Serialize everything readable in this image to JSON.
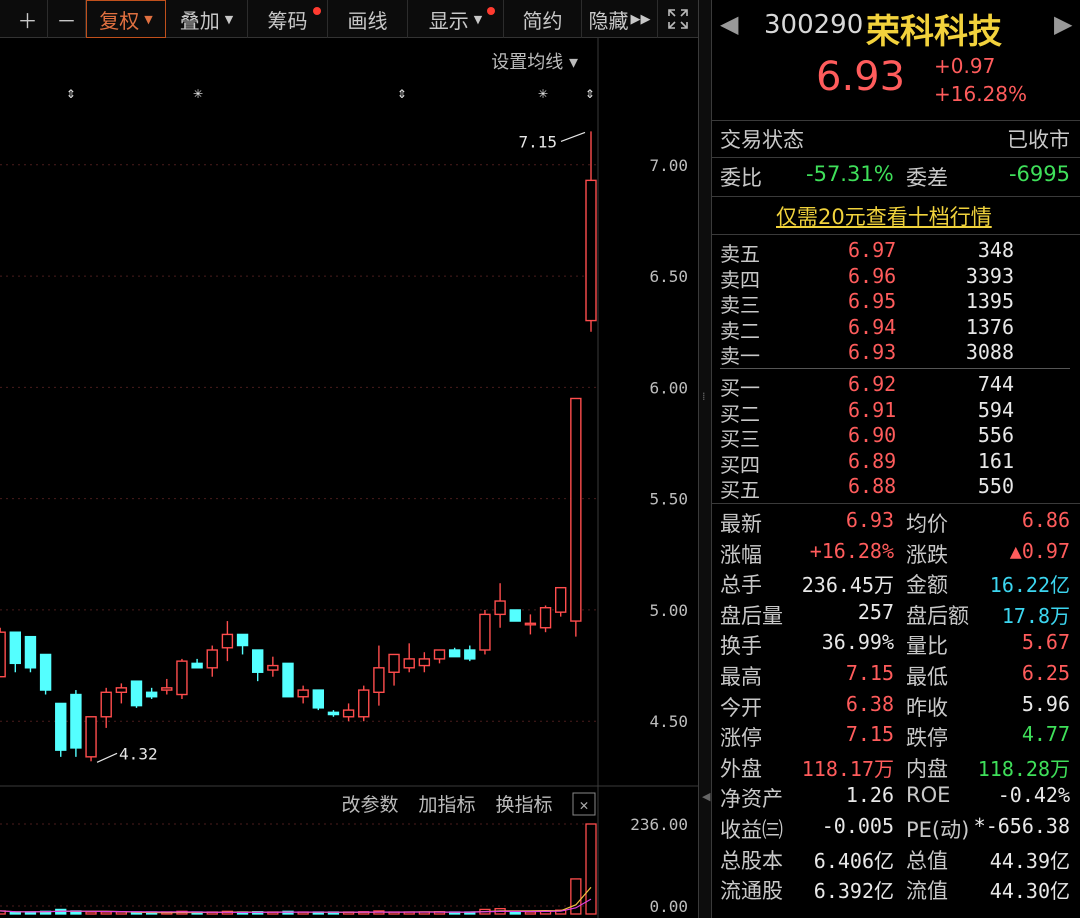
{
  "toolbar": {
    "plus": "＋",
    "minus": "－",
    "fuquan": "复权",
    "diejia": "叠加",
    "chouma": "筹码",
    "huaxian": "画线",
    "xianshi": "显示",
    "jianyue": "简约",
    "yincang": "隐藏",
    "expand_icon": "expand-icon",
    "badge_color": "#ff3b30"
  },
  "chart": {
    "ma_setting": "设置均线",
    "high_label": "7.15",
    "low_label": "4.32",
    "indicator_buttons": [
      "改参数",
      "加指标",
      "换指标"
    ],
    "volume_ticks": [
      "236.00",
      "0.00"
    ],
    "up_color": "#ff4d4d",
    "down_color": "#54ffff"
  },
  "chart_data": {
    "type": "candlestick",
    "y_ticks": [
      "7.00",
      "6.50",
      "6.00",
      "5.50",
      "5.00",
      "4.50"
    ],
    "ylim": [
      4.2,
      7.3
    ],
    "candles": [
      {
        "o": 4.7,
        "h": 4.92,
        "l": 4.7,
        "c": 4.9
      },
      {
        "o": 4.9,
        "h": 4.9,
        "l": 4.72,
        "c": 4.76
      },
      {
        "o": 4.88,
        "h": 4.88,
        "l": 4.72,
        "c": 4.74
      },
      {
        "o": 4.8,
        "h": 4.8,
        "l": 4.62,
        "c": 4.64
      },
      {
        "o": 4.58,
        "h": 4.58,
        "l": 4.34,
        "c": 4.37
      },
      {
        "o": 4.62,
        "h": 4.64,
        "l": 4.34,
        "c": 4.38
      },
      {
        "o": 4.34,
        "h": 4.52,
        "l": 4.32,
        "c": 4.52
      },
      {
        "o": 4.52,
        "h": 4.65,
        "l": 4.47,
        "c": 4.63
      },
      {
        "o": 4.63,
        "h": 4.67,
        "l": 4.58,
        "c": 4.65
      },
      {
        "o": 4.68,
        "h": 4.68,
        "l": 4.56,
        "c": 4.57
      },
      {
        "o": 4.63,
        "h": 4.65,
        "l": 4.6,
        "c": 4.61
      },
      {
        "o": 4.64,
        "h": 4.69,
        "l": 4.62,
        "c": 4.65
      },
      {
        "o": 4.62,
        "h": 4.78,
        "l": 4.6,
        "c": 4.77
      },
      {
        "o": 4.76,
        "h": 4.78,
        "l": 4.74,
        "c": 4.74
      },
      {
        "o": 4.74,
        "h": 4.84,
        "l": 4.7,
        "c": 4.82
      },
      {
        "o": 4.83,
        "h": 4.95,
        "l": 4.77,
        "c": 4.89
      },
      {
        "o": 4.89,
        "h": 4.89,
        "l": 4.8,
        "c": 4.84
      },
      {
        "o": 4.82,
        "h": 4.82,
        "l": 4.68,
        "c": 4.72
      },
      {
        "o": 4.73,
        "h": 4.79,
        "l": 4.7,
        "c": 4.75
      },
      {
        "o": 4.76,
        "h": 4.76,
        "l": 4.62,
        "c": 4.61
      },
      {
        "o": 4.61,
        "h": 4.66,
        "l": 4.58,
        "c": 4.64
      },
      {
        "o": 4.64,
        "h": 4.64,
        "l": 4.55,
        "c": 4.56
      },
      {
        "o": 4.54,
        "h": 4.55,
        "l": 4.52,
        "c": 4.53
      },
      {
        "o": 4.52,
        "h": 4.58,
        "l": 4.5,
        "c": 4.55
      },
      {
        "o": 4.52,
        "h": 4.66,
        "l": 4.5,
        "c": 4.64
      },
      {
        "o": 4.63,
        "h": 4.84,
        "l": 4.57,
        "c": 4.74
      },
      {
        "o": 4.72,
        "h": 4.8,
        "l": 4.66,
        "c": 4.8
      },
      {
        "o": 4.74,
        "h": 4.85,
        "l": 4.72,
        "c": 4.78
      },
      {
        "o": 4.75,
        "h": 4.81,
        "l": 4.72,
        "c": 4.78
      },
      {
        "o": 4.78,
        "h": 4.82,
        "l": 4.76,
        "c": 4.82
      },
      {
        "o": 4.82,
        "h": 4.83,
        "l": 4.79,
        "c": 4.79
      },
      {
        "o": 4.82,
        "h": 4.84,
        "l": 4.77,
        "c": 4.78
      },
      {
        "o": 4.82,
        "h": 5.0,
        "l": 4.8,
        "c": 4.98
      },
      {
        "o": 4.98,
        "h": 5.12,
        "l": 4.92,
        "c": 5.04
      },
      {
        "o": 5.0,
        "h": 5.0,
        "l": 4.95,
        "c": 4.95
      },
      {
        "o": 4.94,
        "h": 4.98,
        "l": 4.89,
        "c": 4.94
      },
      {
        "o": 4.92,
        "h": 5.02,
        "l": 4.9,
        "c": 5.01
      },
      {
        "o": 4.99,
        "h": 5.1,
        "l": 4.97,
        "c": 5.1
      },
      {
        "o": 4.95,
        "h": 5.95,
        "l": 4.88,
        "c": 5.95
      },
      {
        "o": 6.3,
        "h": 7.15,
        "l": 6.25,
        "c": 6.93
      }
    ],
    "volume": [
      8,
      4,
      5,
      7,
      12,
      8,
      5,
      4,
      3,
      3,
      4,
      3,
      7,
      3,
      5,
      7,
      4,
      6,
      3,
      7,
      4,
      5,
      3,
      4,
      6,
      8,
      4,
      5,
      5,
      6,
      4,
      5,
      12,
      14,
      6,
      5,
      7,
      10,
      92,
      236
    ]
  },
  "stock": {
    "code": "300290",
    "name": "荣科科技",
    "price": "6.93",
    "change": "+0.97",
    "change_pct": "+16.28%",
    "trade_status_label": "交易状态",
    "trade_status": "已收市",
    "weibi_label": "委比",
    "weibi": "-57.31%",
    "weicha_label": "委差",
    "weicha": "-6995",
    "promo": "仅需20元查看十档行情"
  },
  "orderbook": {
    "sell": [
      {
        "label": "卖五",
        "price": "6.97",
        "vol": "348"
      },
      {
        "label": "卖四",
        "price": "6.96",
        "vol": "3393"
      },
      {
        "label": "卖三",
        "price": "6.95",
        "vol": "1395"
      },
      {
        "label": "卖二",
        "price": "6.94",
        "vol": "1376"
      },
      {
        "label": "卖一",
        "price": "6.93",
        "vol": "3088"
      }
    ],
    "buy": [
      {
        "label": "买一",
        "price": "6.92",
        "vol": "744"
      },
      {
        "label": "买二",
        "price": "6.91",
        "vol": "594"
      },
      {
        "label": "买三",
        "price": "6.90",
        "vol": "556"
      },
      {
        "label": "买四",
        "price": "6.89",
        "vol": "161"
      },
      {
        "label": "买五",
        "price": "6.88",
        "vol": "550"
      }
    ]
  },
  "quote": [
    {
      "l1": "最新",
      "v1": "6.93",
      "c1": "red",
      "l2": "均价",
      "v2": "6.86",
      "c2": "red"
    },
    {
      "l1": "涨幅",
      "v1": "+16.28%",
      "c1": "red",
      "l2": "涨跌",
      "v2": "▲0.97",
      "c2": "red"
    },
    {
      "l1": "总手",
      "v1": "236.45万",
      "c1": "white",
      "l2": "金额",
      "v2": "16.22亿",
      "c2": "cyan"
    },
    {
      "l1": "盘后量",
      "v1": "257",
      "c1": "white",
      "l2": "盘后额",
      "v2": "17.8万",
      "c2": "cyan"
    },
    {
      "l1": "换手",
      "v1": "36.99%",
      "c1": "white",
      "l2": "量比",
      "v2": "5.67",
      "c2": "red"
    },
    {
      "l1": "最高",
      "v1": "7.15",
      "c1": "red",
      "l2": "最低",
      "v2": "6.25",
      "c2": "red"
    },
    {
      "l1": "今开",
      "v1": "6.38",
      "c1": "red",
      "l2": "昨收",
      "v2": "5.96",
      "c2": "white"
    },
    {
      "l1": "涨停",
      "v1": "7.15",
      "c1": "red",
      "l2": "跌停",
      "v2": "4.77",
      "c2": "green"
    },
    {
      "l1": "外盘",
      "v1": "118.17万",
      "c1": "red",
      "l2": "内盘",
      "v2": "118.28万",
      "c2": "green"
    },
    {
      "l1": "净资产",
      "v1": "1.26",
      "c1": "white",
      "l2": "ROE",
      "v2": "-0.42%",
      "c2": "white"
    },
    {
      "l1": "收益㈢",
      "v1": "-0.005",
      "c1": "white",
      "l2": "PE(动)",
      "v2": "*-656.38",
      "c2": "white"
    },
    {
      "l1": "总股本",
      "v1": "6.406亿",
      "c1": "white",
      "l2": "总值",
      "v2": "44.39亿",
      "c2": "white"
    },
    {
      "l1": "流通股",
      "v1": "6.392亿",
      "c1": "white",
      "l2": "流值",
      "v2": "44.30亿",
      "c2": "white"
    }
  ]
}
